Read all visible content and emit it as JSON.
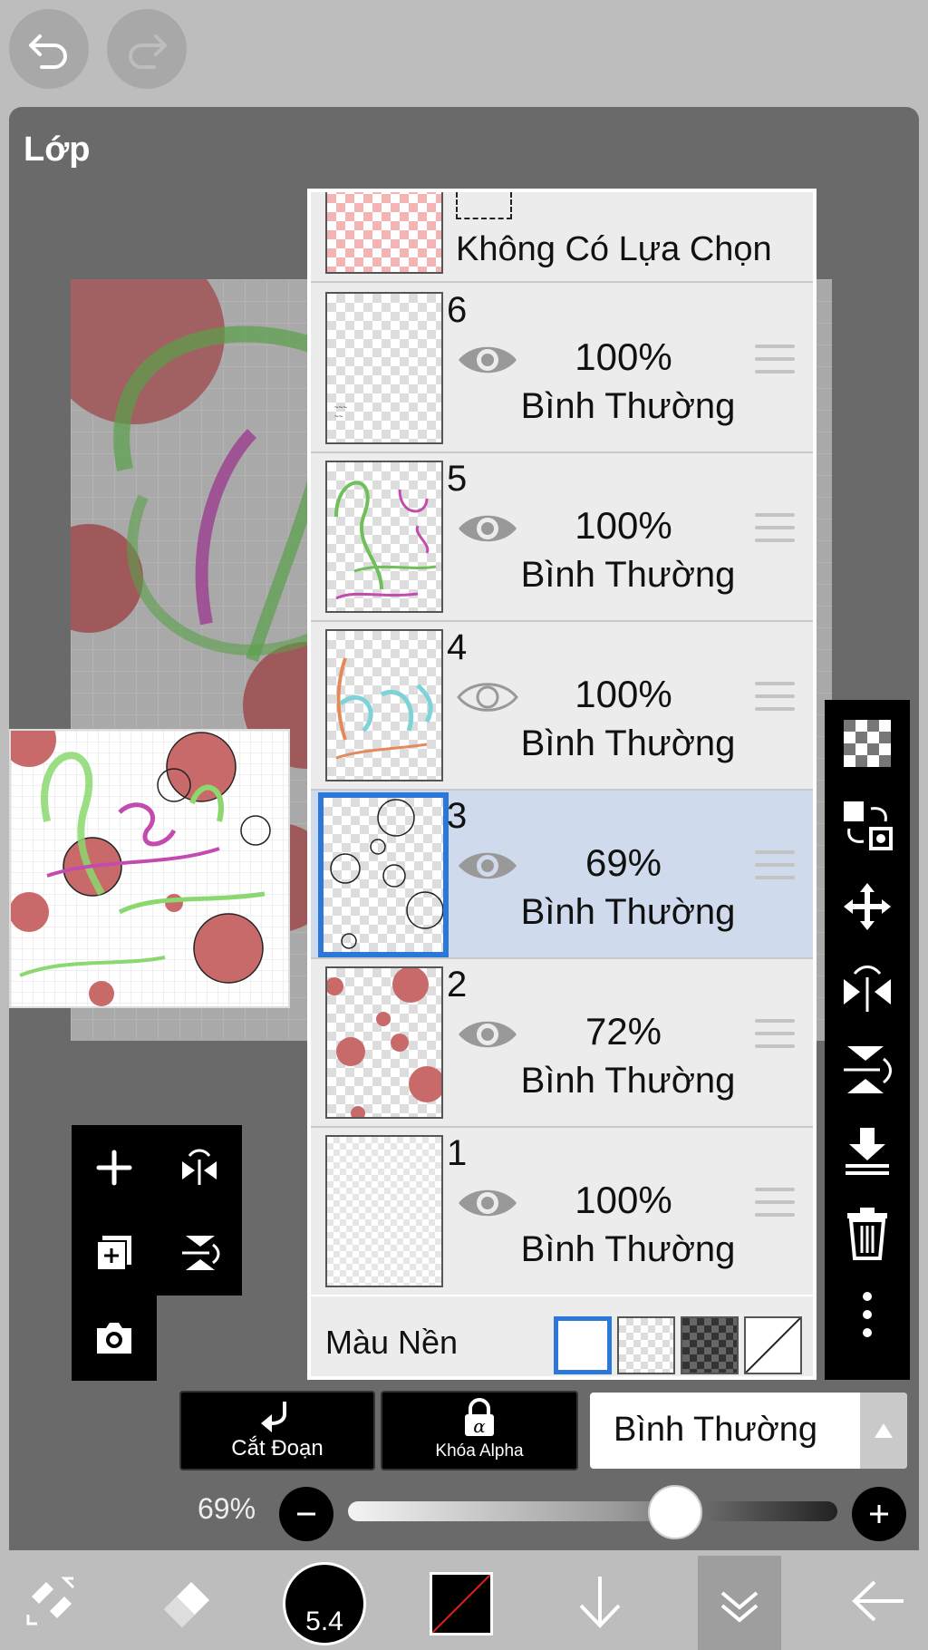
{
  "panel": {
    "title": "Lớp"
  },
  "selection_layer": {
    "label": "Không Có Lựa Chọn"
  },
  "layers": [
    {
      "number": "6",
      "opacity": "100%",
      "blend": "Bình Thường",
      "visible": true,
      "selected": false
    },
    {
      "number": "5",
      "opacity": "100%",
      "blend": "Bình Thường",
      "visible": true,
      "selected": false
    },
    {
      "number": "4",
      "opacity": "100%",
      "blend": "Bình Thường",
      "visible": false,
      "selected": false
    },
    {
      "number": "3",
      "opacity": "69%",
      "blend": "Bình Thường",
      "visible": true,
      "selected": true
    },
    {
      "number": "2",
      "opacity": "72%",
      "blend": "Bình Thường",
      "visible": true,
      "selected": false
    },
    {
      "number": "1",
      "opacity": "100%",
      "blend": "Bình Thường",
      "visible": true,
      "selected": false
    }
  ],
  "background": {
    "label": "Màu Nền",
    "options": [
      "white",
      "transparent-light",
      "transparent-dark",
      "none"
    ],
    "selected": "white"
  },
  "actions": {
    "clip_label": "Cắt Đoạn",
    "alpha_lock_label": "Khóa Alpha"
  },
  "blend_mode": {
    "value": "Bình Thường"
  },
  "opacity": {
    "label": "69%",
    "value": 0.69
  },
  "toolbar": {
    "brush_size": "5.4"
  },
  "colors": {
    "accent": "#2b78d8",
    "selected_row": "#cfdaec",
    "blob": "#c96a6a",
    "stroke_green": "#6fbf5a",
    "stroke_pink": "#c34bb0"
  }
}
